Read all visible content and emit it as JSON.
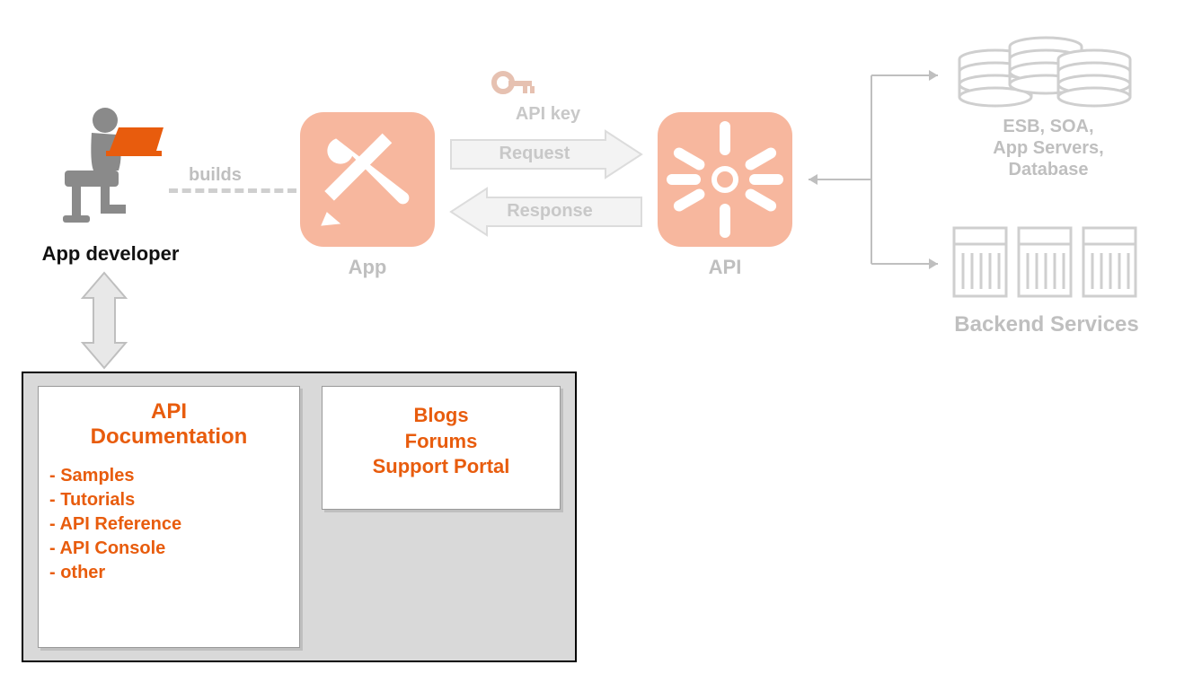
{
  "developer": {
    "label": "App developer"
  },
  "builds_label": "builds",
  "app": {
    "label": "App"
  },
  "api": {
    "label": "API"
  },
  "flow": {
    "api_key": "API key",
    "request": "Request",
    "response": "Response"
  },
  "backend": {
    "group1": "ESB, SOA,",
    "group1_line2": "App Servers,",
    "group1_line3": "Database",
    "title": "Backend Services"
  },
  "portal": {
    "docs": {
      "title_line1": "API",
      "title_line2": "Documentation",
      "items": [
        "- Samples",
        "- Tutorials",
        "- API Reference",
        "- API Console",
        "- other"
      ]
    },
    "community": {
      "line1": "Blogs",
      "line2": "Forums",
      "line3": "Support Portal"
    }
  },
  "colors": {
    "orange": "#e85c0d",
    "dim": "#bfbfbf",
    "app_tile": "#f7b79e",
    "portal_bg": "#d9d9d9"
  }
}
